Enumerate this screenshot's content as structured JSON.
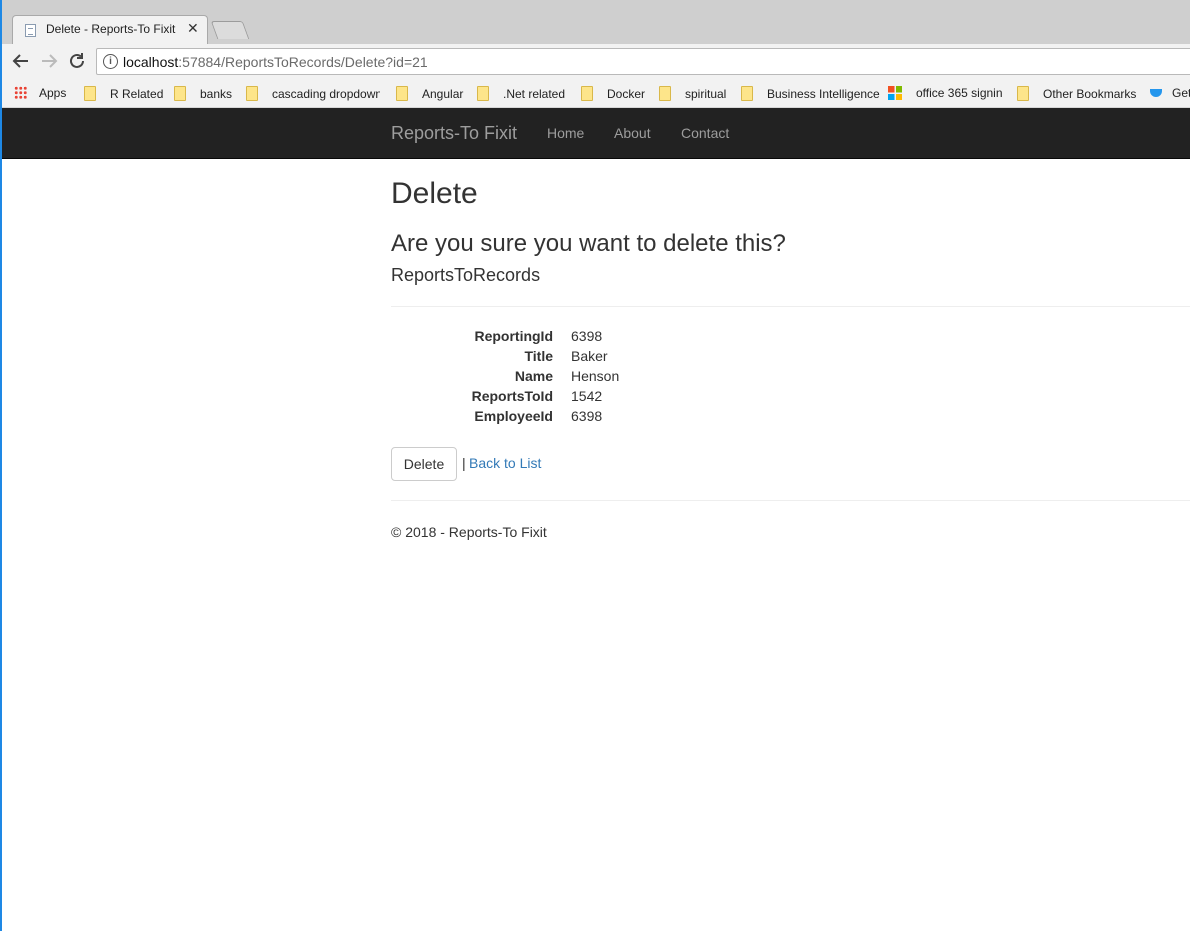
{
  "browser": {
    "tab_title": "Delete - Reports-To Fixit",
    "tab_close": "✕",
    "url_host": "localhost",
    "url_rest": ":57884/ReportsToRecords/Delete?id=21",
    "bookmarks": [
      "Apps",
      "R Related",
      "banks",
      "cascading dropdown",
      "Angular",
      ".Net related",
      "Docker",
      "spiritual",
      "Business Intelligence",
      "office 365 signin",
      "Other Bookmarks",
      "Get"
    ]
  },
  "navbar": {
    "brand": "Reports-To Fixit",
    "links": [
      "Home",
      "About",
      "Contact"
    ]
  },
  "page": {
    "title": "Delete",
    "confirm": "Are you sure you want to delete this?",
    "entity": "ReportsToRecords",
    "fields": [
      {
        "label": "ReportingId",
        "value": "6398"
      },
      {
        "label": "Title",
        "value": "Baker"
      },
      {
        "label": "Name",
        "value": "Henson"
      },
      {
        "label": "ReportsToId",
        "value": "1542"
      },
      {
        "label": "EmployeeId",
        "value": "6398"
      }
    ],
    "delete_label": "Delete",
    "separator": "|",
    "back_label": "Back to List"
  },
  "footer": {
    "text": "© 2018 - Reports-To Fixit"
  },
  "colors": {
    "navbar_bg": "#222222",
    "link": "#337ab7"
  }
}
